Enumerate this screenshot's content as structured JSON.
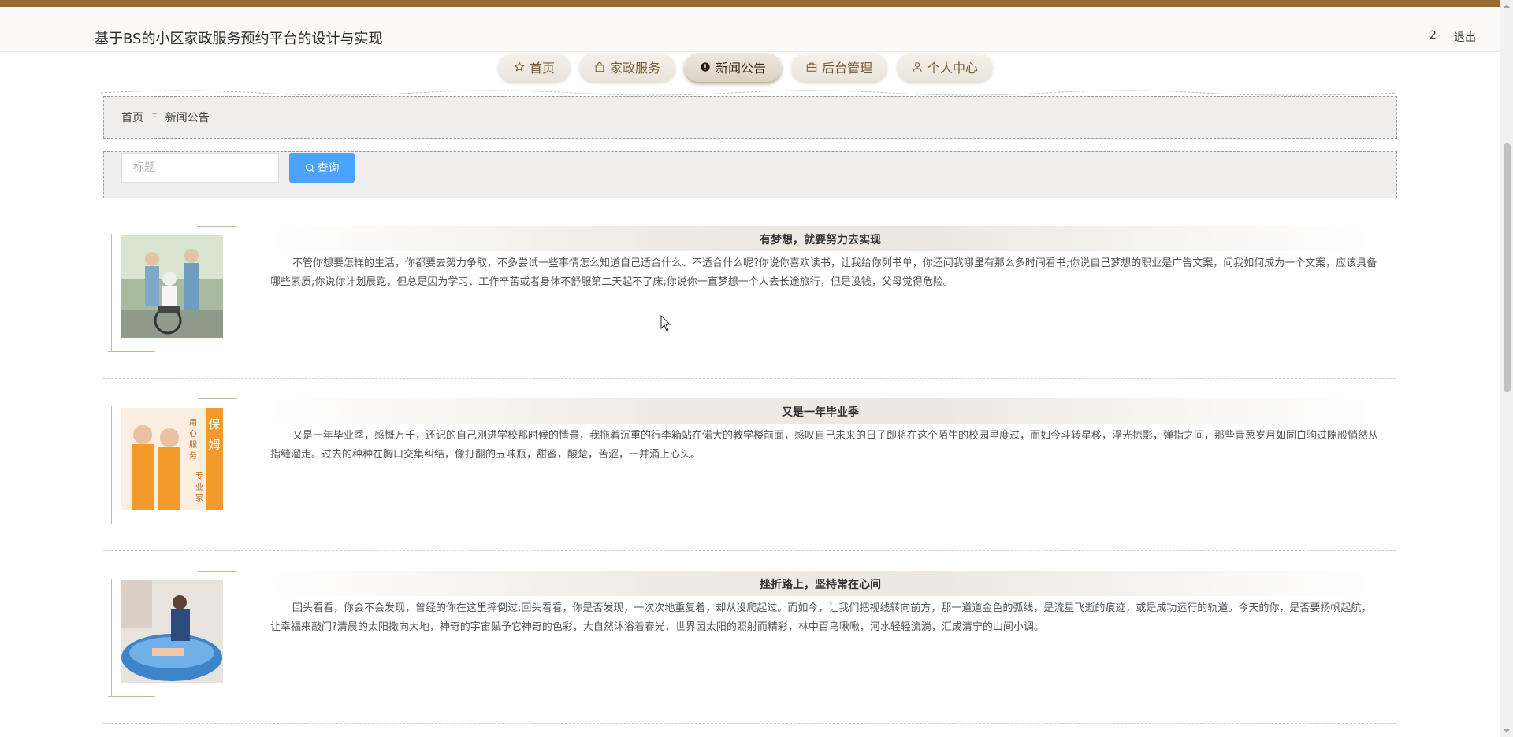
{
  "header": {
    "site_title": "基于BS的小区家政服务预约平台的设计与实现",
    "user_count": "2",
    "logout_label": "退出"
  },
  "nav": {
    "items": [
      {
        "label": "首页",
        "icon": "star-icon"
      },
      {
        "label": "家政服务",
        "icon": "bag-icon"
      },
      {
        "label": "新闻公告",
        "icon": "alert-circle-icon",
        "active": true
      },
      {
        "label": "后台管理",
        "icon": "briefcase-icon"
      },
      {
        "label": "个人中心",
        "icon": "user-icon"
      }
    ]
  },
  "breadcrumb": {
    "home": "首页",
    "separator": "Ξ",
    "current": "新闻公告"
  },
  "search": {
    "placeholder": "标题",
    "button_label": "查询"
  },
  "news": [
    {
      "title": "有梦想，就要努力去实现",
      "body": "不管你想要怎样的生活，你都要去努力争取，不多尝试一些事情怎么知道自己适合什么、不适合什么呢?你说你喜欢读书，让我给你列书单，你还问我哪里有那么多时间看书;你说自己梦想的职业是广告文案，问我如何成为一个文案，应该具备哪些素质;你说你计划晨跑，但总是因为学习、工作辛苦或者身体不舒服第二天起不了床;你说你一直梦想一个人去长途旅行，但是没钱，父母觉得危险。",
      "image": "caregiver-with-elderly-wheelchair"
    },
    {
      "title": "又是一年毕业季",
      "body": "又是一年毕业季，感慨万千，还记的自己刚进学校那时候的情景，我拖着沉重的行李箱站在偌大的教学楼前面，感叹自己未来的日子即将在这个陌生的校园里度过，而如今斗转星移，浮光掠影，弹指之间，那些青葱岁月如同白驹过隙般悄然从指缝溜走。过去的种种在胸口交集纠结，像打翻的五味瓶，甜蜜，酸楚，苦涩，一并涌上心头。",
      "image": "housekeeping-poster",
      "image_text": [
        "保",
        "姆",
        "用",
        "专",
        "心",
        "业",
        "服",
        "务",
        "家"
      ]
    },
    {
      "title": "挫折路上，坚持常在心间",
      "body": "回头看看，你会不会发现，曾经的你在这里摔倒过;回头看看，你是否发现，一次次地重复着，却从没爬起过。而如今，让我们把视线转向前方，那一道道金色的弧线，是流星飞逝的痕迹，或是成功运行的轨道。今天的你，是否要扬帆起航，让幸福来敲门?清晨的太阳撒向大地，神奇的宇宙赋予它神奇的色彩，大自然沐浴着春光，世界因太阳的照射而精彩，林中百鸟啾啾，河水轻轻流淌，汇成清宁的山间小调。",
      "image": "baby-bath-pool"
    }
  ],
  "colors": {
    "top_bar": "#9a6a35",
    "search_button": "#4aa3ff",
    "nav_text": "#7a5a32"
  }
}
